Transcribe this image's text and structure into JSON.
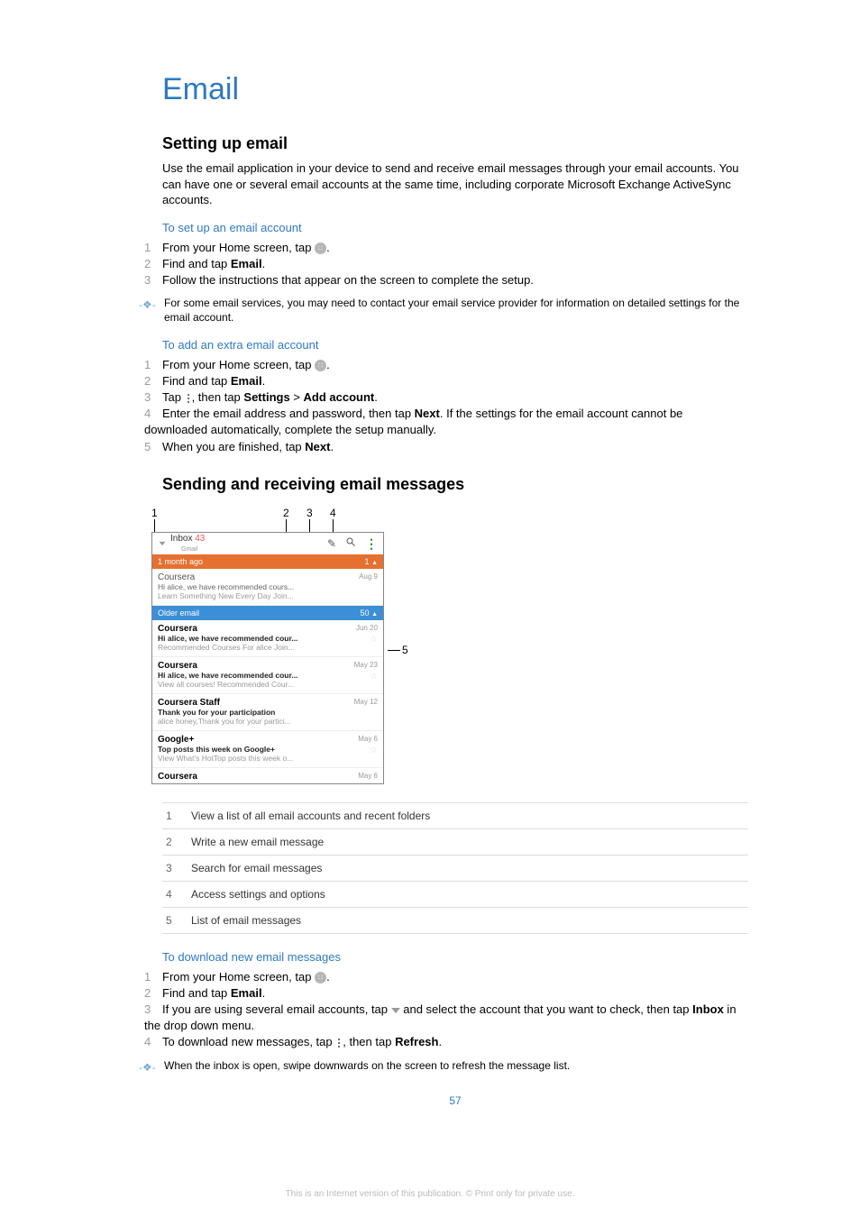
{
  "title": "Email",
  "section1": {
    "heading": "Setting up email",
    "intro": "Use the email application in your device to send and receive email messages through your email accounts. You can have one or several email accounts at the same time, including corporate Microsoft Exchange ActiveSync accounts.",
    "sub1": "To set up an email account",
    "steps1": {
      "s1_pre": "From your Home screen, tap ",
      "s1_post": ".",
      "s2_pre": "Find and tap ",
      "s2_bold": "Email",
      "s2_post": ".",
      "s3": "Follow the instructions that appear on the screen to complete the setup."
    },
    "note1": "For some email services, you may need to contact your email service provider for information on detailed settings for the email account.",
    "sub2": "To add an extra email account",
    "steps2": {
      "s1_pre": "From your Home screen, tap ",
      "s1_post": ".",
      "s2_pre": "Find and tap ",
      "s2_bold": "Email",
      "s2_post": ".",
      "s3_pre": "Tap ",
      "s3_mid": ", then tap ",
      "s3_b1": "Settings",
      "s3_gt": " > ",
      "s3_b2": "Add account",
      "s3_post": ".",
      "s4_pre": "Enter the email address and password, then tap ",
      "s4_b": "Next",
      "s4_post": ". If the settings for the email account cannot be downloaded automatically, complete the setup manually.",
      "s5_pre": "When you are finished, tap ",
      "s5_b": "Next",
      "s5_post": "."
    }
  },
  "section2": {
    "heading": "Sending and receiving email messages",
    "callouts": {
      "c1": "1",
      "c2": "2",
      "c3": "3",
      "c4": "4",
      "c5": "5"
    },
    "phone": {
      "inbox_label": "Inbox",
      "inbox_count": "43",
      "gmail": "Gmail",
      "band1_label": "1 month ago",
      "band1_count": "1",
      "band2_label": "Older email",
      "band2_count": "50",
      "msgs": [
        {
          "from": "Coursera",
          "subj": "Hi alice, we have recommended cours...",
          "prev": "Learn Something New Every Day Join...",
          "date": "Aug 9",
          "read": true
        },
        {
          "from": "Coursera",
          "subj": "Hi alice, we have recommended cour...",
          "prev": "Recommended Courses For alice Join...",
          "date": "Jun 20",
          "read": false
        },
        {
          "from": "Coursera",
          "subj": "Hi alice, we have recommended cour...",
          "prev": "View all courses! Recommended Cour...",
          "date": "May 23",
          "read": false
        },
        {
          "from": "Coursera Staff",
          "subj": "Thank you for your participation",
          "prev": "alice honey,Thank you for your partici...",
          "date": "May 12",
          "read": false
        },
        {
          "from": "Google+",
          "subj": "Top posts this week on Google+",
          "prev": "View What's HotTop posts this week o...",
          "date": "May 6",
          "read": false
        },
        {
          "from": "Coursera",
          "subj": "",
          "prev": "",
          "date": "May 6",
          "read": false
        }
      ]
    },
    "legend": [
      {
        "n": "1",
        "d": "View a list of all email accounts and recent folders"
      },
      {
        "n": "2",
        "d": "Write a new email message"
      },
      {
        "n": "3",
        "d": "Search for email messages"
      },
      {
        "n": "4",
        "d": "Access settings and options"
      },
      {
        "n": "5",
        "d": "List of email messages"
      }
    ],
    "sub1": "To download new email messages",
    "steps1": {
      "s1_pre": "From your Home screen, tap ",
      "s1_post": ".",
      "s2_pre": "Find and tap ",
      "s2_bold": "Email",
      "s2_post": ".",
      "s3_pre": "If you are using several email accounts, tap ",
      "s3_mid": " and select the account that you want to check, then tap ",
      "s3_b": "Inbox",
      "s3_post": " in the drop down menu.",
      "s4_pre": "To download new messages, tap ",
      "s4_mid": ", then tap ",
      "s4_b": "Refresh",
      "s4_post": "."
    },
    "note1": "When the inbox is open, swipe downwards on the screen to refresh the message list."
  },
  "pageNumber": "57",
  "footer": "This is an Internet version of this publication. © Print only for private use."
}
